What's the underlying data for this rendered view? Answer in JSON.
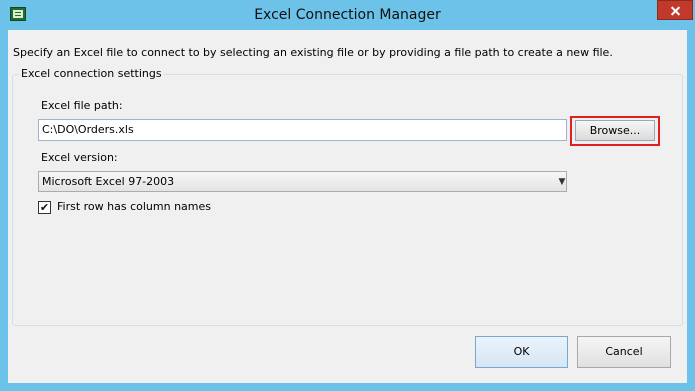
{
  "window": {
    "title": "Excel Connection Manager",
    "icon": "excel-app-icon",
    "close_icon": "close-icon"
  },
  "intro_text": "Specify an Excel file to connect to by selecting an existing file or by providing a file path to create a new file.",
  "group": {
    "legend": "Excel connection settings",
    "file_path_label": "Excel file path:",
    "file_path_value": "C:\\DO\\Orders.xls",
    "browse_label": "Browse...",
    "version_label": "Excel version:",
    "version_value": "Microsoft Excel 97-2003",
    "first_row_label": "First row has column names",
    "first_row_checked": true
  },
  "buttons": {
    "ok": "OK",
    "cancel": "Cancel"
  },
  "colors": {
    "titlebar": "#6cc2e8",
    "highlight": "#e02020",
    "close": "#c0392b"
  }
}
